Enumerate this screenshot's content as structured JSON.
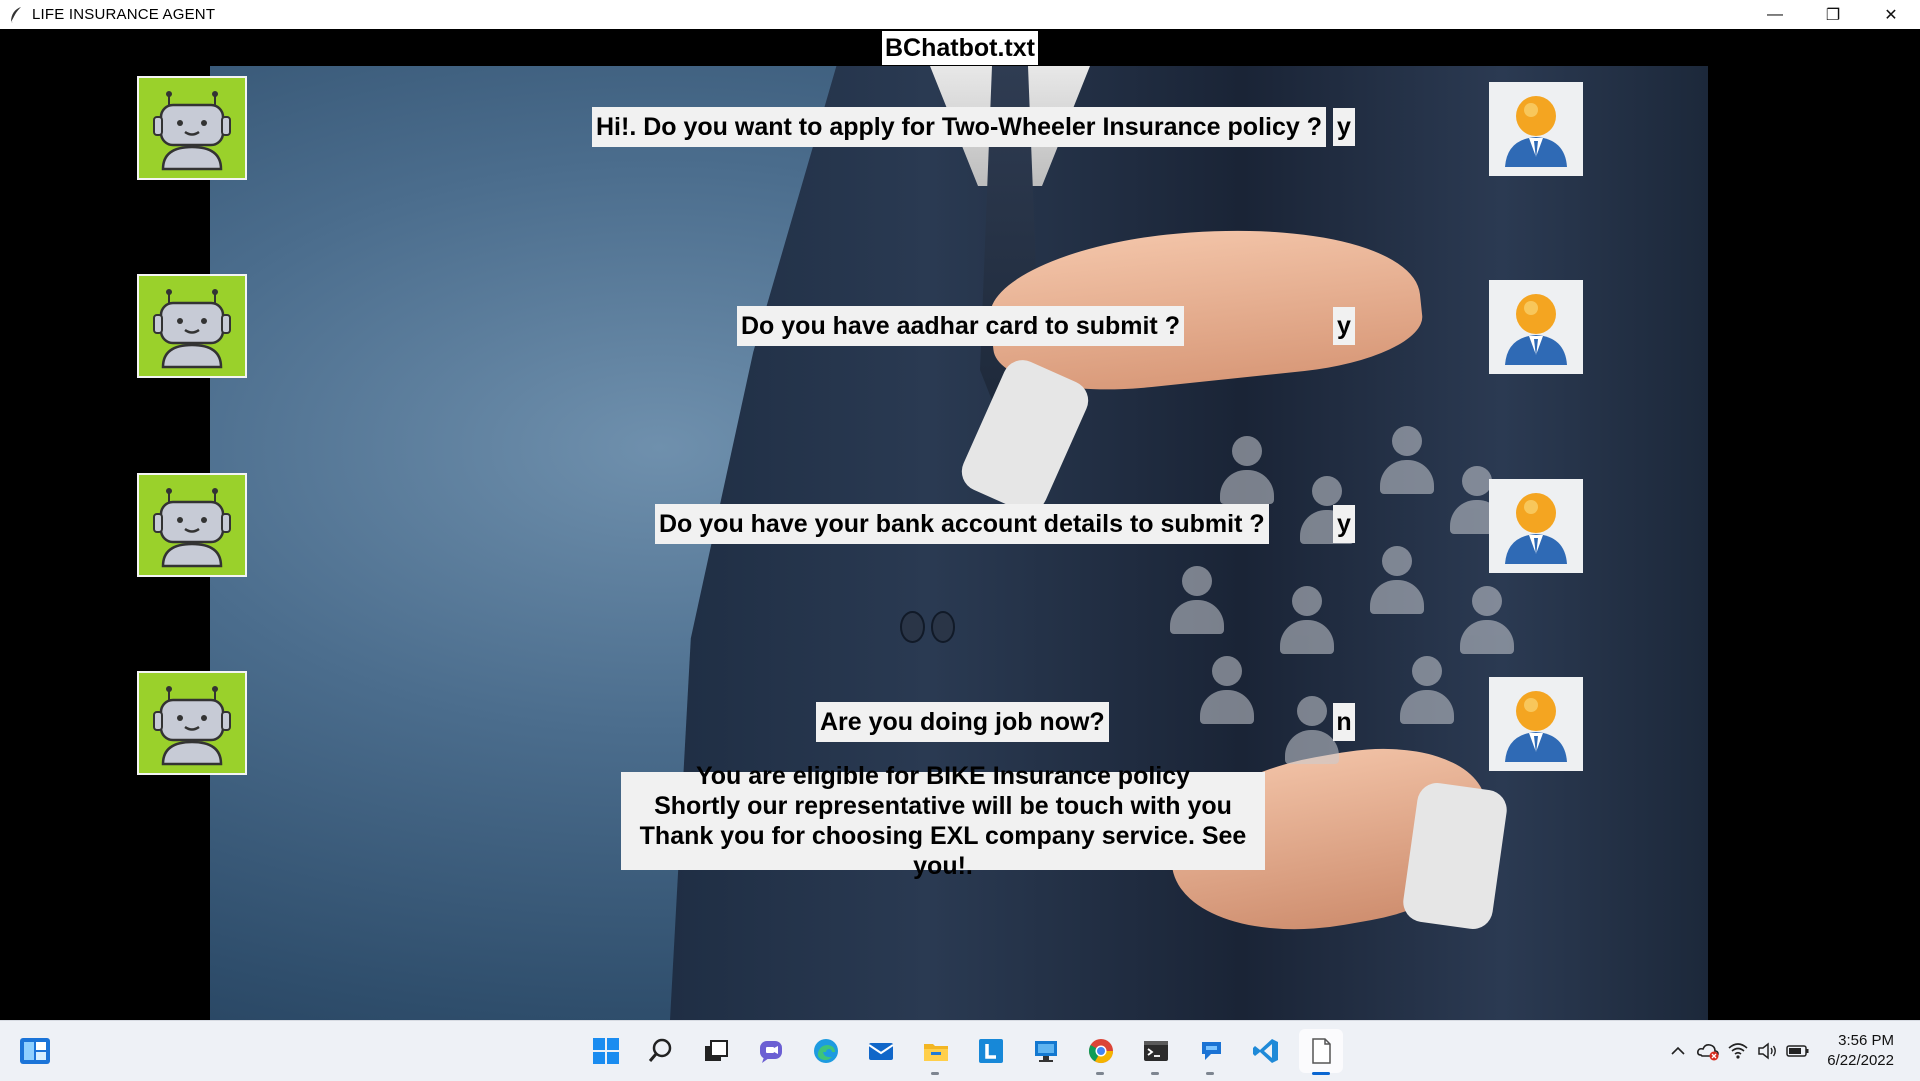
{
  "window": {
    "title": "LIFE INSURANCE AGENT",
    "minimize_glyph": "—",
    "restore_glyph": "❐",
    "close_glyph": "✕"
  },
  "file_label": "BChatbot.txt",
  "conversation": [
    {
      "question": "Hi!. Do you want to apply for Two-Wheeler Insurance policy ?",
      "answer": "y"
    },
    {
      "question": "Do you have aadhar card to submit ?",
      "answer": "y"
    },
    {
      "question": "Do you have your bank account details to submit ?",
      "answer": "y"
    },
    {
      "question": "Are you doing job now?",
      "answer": "n"
    }
  ],
  "final_message": {
    "line1": "You are eligible for BIKE Insurance policy",
    "line2": "Shortly our representative will be touch with you",
    "line3": "Thank you for choosing EXL company service. See you!."
  },
  "taskbar": {
    "apps": [
      "start-icon",
      "search-icon",
      "task-view-icon",
      "chat-icon",
      "edge-icon",
      "mail-icon",
      "file-explorer-icon",
      "app-l-icon",
      "remote-desktop-icon",
      "chrome-icon",
      "terminal-icon",
      "quick-assist-icon",
      "vscode-icon",
      "notepad-icon"
    ],
    "time": "3:56 PM",
    "date": "6/22/2022"
  },
  "colors": {
    "bot_bg": "#9ad12b",
    "taskbar_bg": "#eef1f6",
    "label_bg": "#f1f1f1"
  }
}
